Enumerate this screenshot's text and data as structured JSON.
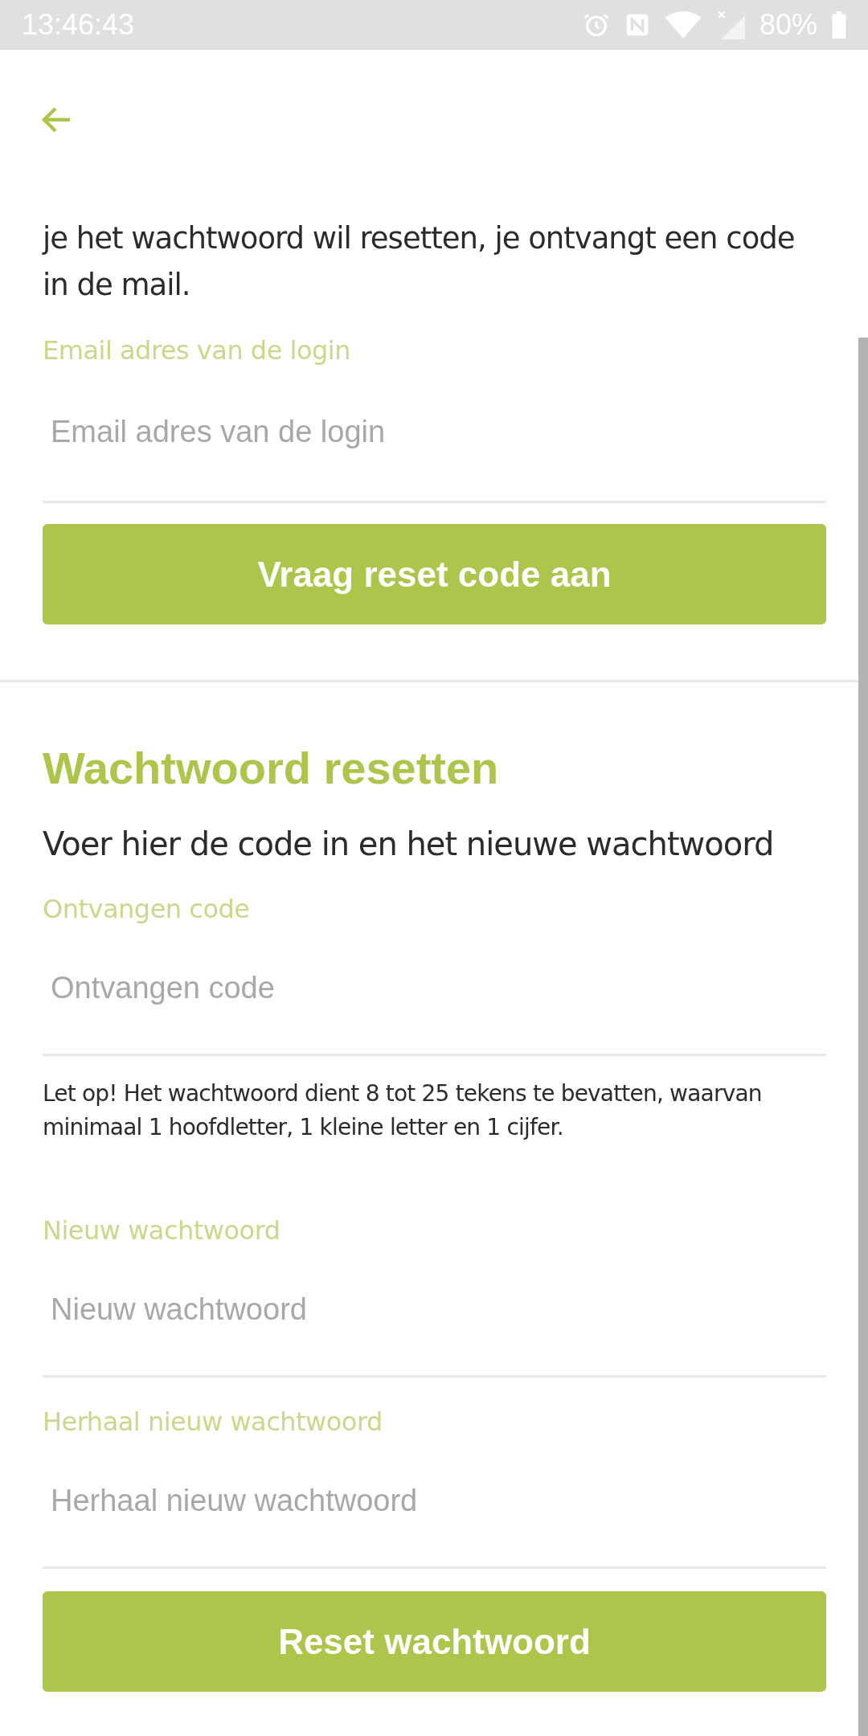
{
  "status_bar": {
    "time": "13:46:43",
    "battery": "80%"
  },
  "request_section": {
    "intro": "je het wachtwoord wil resetten, je ontvangt een code in de mail.",
    "field": {
      "label": "Email adres van de login",
      "placeholder": "Email adres van de login"
    },
    "button": "Vraag reset code aan"
  },
  "reset_section": {
    "title": "Wachtwoord resetten",
    "subtitle": "Voer hier de code in en het nieuwe wachtwoord",
    "code_field": {
      "label": "Ontvangen code",
      "placeholder": "Ontvangen code"
    },
    "note": "Let op! Het wachtwoord dient 8 tot 25 tekens te bevatten, waarvan minimaal 1 hoofdletter, 1 kleine letter en 1 cijfer.",
    "password_fields": [
      {
        "label": "Nieuw wachtwoord",
        "placeholder": "Nieuw wachtwoord"
      },
      {
        "label": "Herhaal nieuw wachtwoord",
        "placeholder": "Herhaal nieuw wachtwoord"
      }
    ],
    "button": "Reset wachtwoord"
  }
}
